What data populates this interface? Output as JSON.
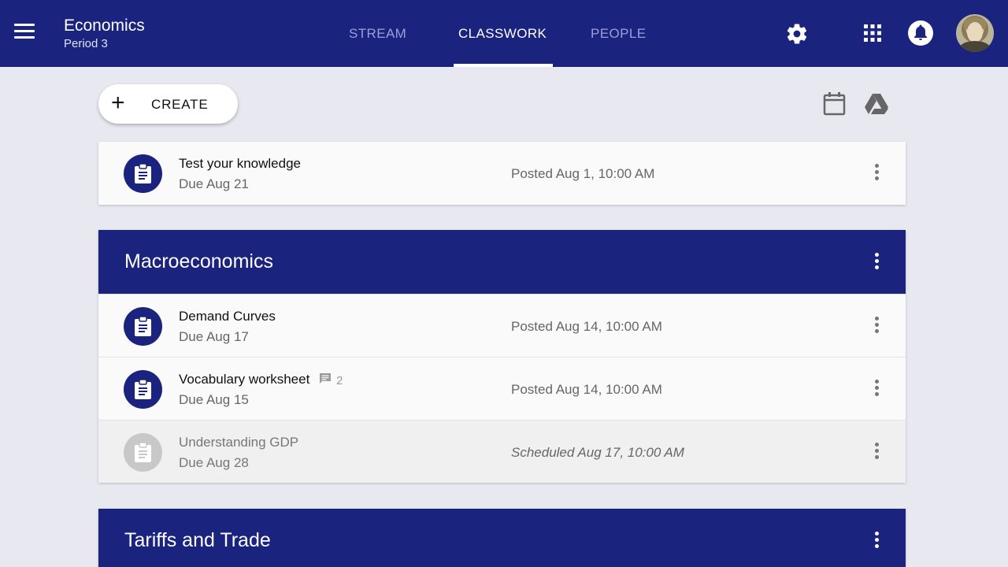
{
  "header": {
    "class_name": "Economics",
    "section": "Period 3",
    "tabs": [
      {
        "label": "STREAM",
        "active": false
      },
      {
        "label": "CLASSWORK",
        "active": true
      },
      {
        "label": "PEOPLE",
        "active": false
      }
    ],
    "icons": [
      "menu-icon",
      "gear-icon",
      "apps-icon",
      "bell-icon",
      "avatar"
    ]
  },
  "toolbar": {
    "create_label": "CREATE",
    "icons": [
      "calendar-icon",
      "drive-icon"
    ]
  },
  "colors": {
    "primary": "#1a237e",
    "background": "#e8e8f1",
    "card": "#fafafa",
    "scheduled_icon": "#c8c8c8"
  },
  "ungrouped": [
    {
      "title": "Test your knowledge",
      "due": "Due Aug 21",
      "posted": "Posted Aug 1, 10:00 AM",
      "scheduled": false
    }
  ],
  "topics": [
    {
      "title": "Macroeconomics",
      "items": [
        {
          "title": "Demand Curves",
          "due": "Due Aug 17",
          "posted": "Posted Aug 14, 10:00 AM",
          "scheduled": false
        },
        {
          "title": "Vocabulary worksheet",
          "due": "Due Aug 15",
          "posted": "Posted Aug 14, 10:00 AM",
          "scheduled": false,
          "comments": "2"
        },
        {
          "title": "Understanding GDP",
          "due": "Due Aug 28",
          "posted": "Scheduled Aug 17, 10:00 AM",
          "scheduled": true
        }
      ]
    },
    {
      "title": "Tariffs and Trade",
      "items": []
    }
  ]
}
